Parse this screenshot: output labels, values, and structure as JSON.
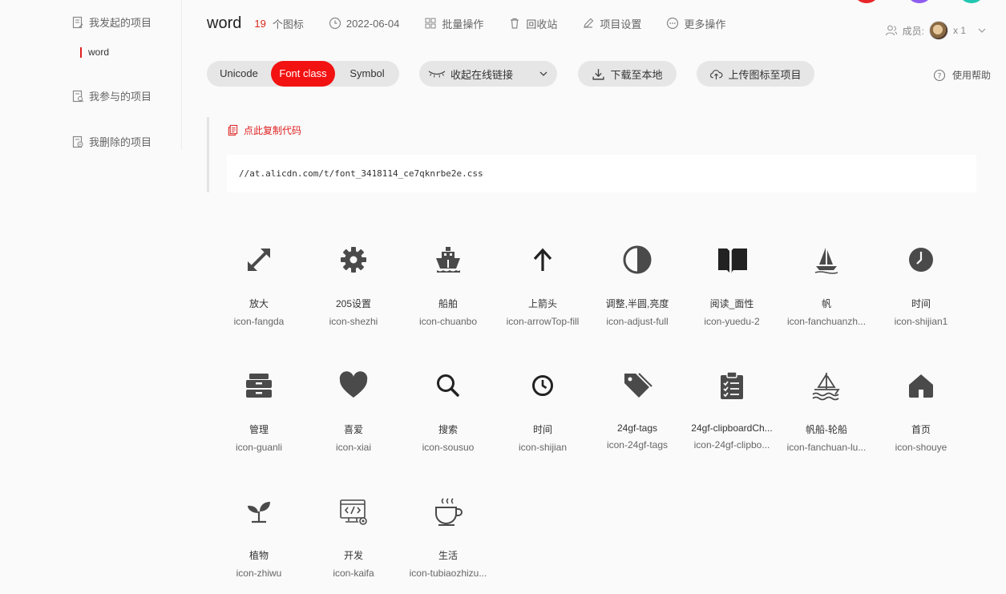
{
  "sidebar": {
    "my_projects": "我发起的项目",
    "current_project": "word",
    "joined_projects": "我参与的项目",
    "deleted_projects": "我删除的项目"
  },
  "header": {
    "title": "word",
    "icon_count": "19",
    "icon_count_label": "个图标",
    "date": "2022-06-04",
    "batch": "批量操作",
    "recycle": "回收站",
    "settings": "项目设置",
    "more": "更多操作",
    "member_label": "成员:",
    "member_count": "x 1"
  },
  "toolbar": {
    "tabs": [
      "Unicode",
      "Font class",
      "Symbol"
    ],
    "active_tab": "Font class",
    "collapse_link": "收起在线链接",
    "download": "下载至本地",
    "upload": "上传图标至项目",
    "help": "使用帮助"
  },
  "code": {
    "copy_label": "点此复制代码",
    "url": "//at.alicdn.com/t/font_3418114_ce7qknrbe2e.css"
  },
  "icons": [
    {
      "name": "放大",
      "cls": "icon-fangda",
      "icon": "expand-arrows-icon"
    },
    {
      "name": "205设置",
      "cls": "icon-shezhi",
      "icon": "gear-icon"
    },
    {
      "name": "船舶",
      "cls": "icon-chuanbo",
      "icon": "ship-icon"
    },
    {
      "name": "上箭头",
      "cls": "icon-arrowTop-fill",
      "icon": "arrow-up-icon"
    },
    {
      "name": "调整,半圆,亮度",
      "cls": "icon-adjust-full",
      "icon": "half-circle-icon"
    },
    {
      "name": "阅读_面性",
      "cls": "icon-yuedu-2",
      "icon": "book-icon"
    },
    {
      "name": "帆",
      "cls": "icon-fanchuanzh...",
      "icon": "sailboat-icon"
    },
    {
      "name": "时间",
      "cls": "icon-shijian1",
      "icon": "clock-filled-icon"
    },
    {
      "name": "管理",
      "cls": "icon-guanli",
      "icon": "drawer-icon"
    },
    {
      "name": "喜爱",
      "cls": "icon-xiai",
      "icon": "heart-icon"
    },
    {
      "name": "搜索",
      "cls": "icon-sousuo",
      "icon": "search-icon"
    },
    {
      "name": "时间",
      "cls": "icon-shijian",
      "icon": "clock-outline-icon"
    },
    {
      "name": "24gf-tags",
      "cls": "icon-24gf-tags",
      "icon": "tag-icon"
    },
    {
      "name": "24gf-clipboardCh...",
      "cls": "icon-24gf-clipbo...",
      "icon": "clipboard-check-icon"
    },
    {
      "name": "帆船-轮船",
      "cls": "icon-fanchuan-lu...",
      "icon": "boat-waves-icon"
    },
    {
      "name": "首页",
      "cls": "icon-shouye",
      "icon": "home-icon"
    },
    {
      "name": "植物",
      "cls": "icon-zhiwu",
      "icon": "sprout-icon"
    },
    {
      "name": "开发",
      "cls": "icon-kaifa",
      "icon": "dev-monitor-icon"
    },
    {
      "name": "生活",
      "cls": "icon-tubiaozhizu...",
      "icon": "coffee-cup-icon"
    }
  ],
  "colors": {
    "accent": "#f21212",
    "icon": "#4a4a4a"
  }
}
